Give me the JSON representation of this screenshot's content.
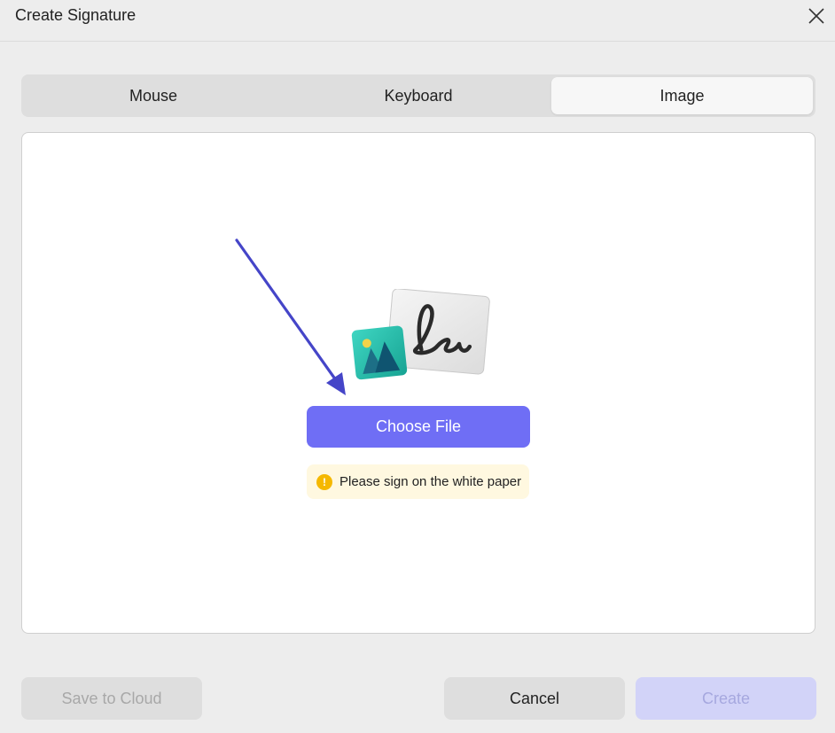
{
  "dialog": {
    "title": "Create Signature",
    "close_icon": "close-icon"
  },
  "tabs": [
    {
      "label": "Mouse",
      "selected": false
    },
    {
      "label": "Keyboard",
      "selected": false
    },
    {
      "label": "Image",
      "selected": true
    }
  ],
  "panel": {
    "illustration_icon": "image-signature-illustration",
    "annotation_icon": "arrow-annotation",
    "choose_file_label": "Choose File",
    "hint_icon": "warning-icon",
    "hint_text": "Please sign on the white paper"
  },
  "footer": {
    "save_to_cloud_label": "Save to Cloud",
    "cancel_label": "Cancel",
    "create_label": "Create"
  },
  "colors": {
    "accent": "#6f6ef5",
    "create_disabled": "#d2d3f8",
    "hint_background": "#fff8e0",
    "hint_icon": "#f5b800",
    "arrow": "#4545c8"
  }
}
